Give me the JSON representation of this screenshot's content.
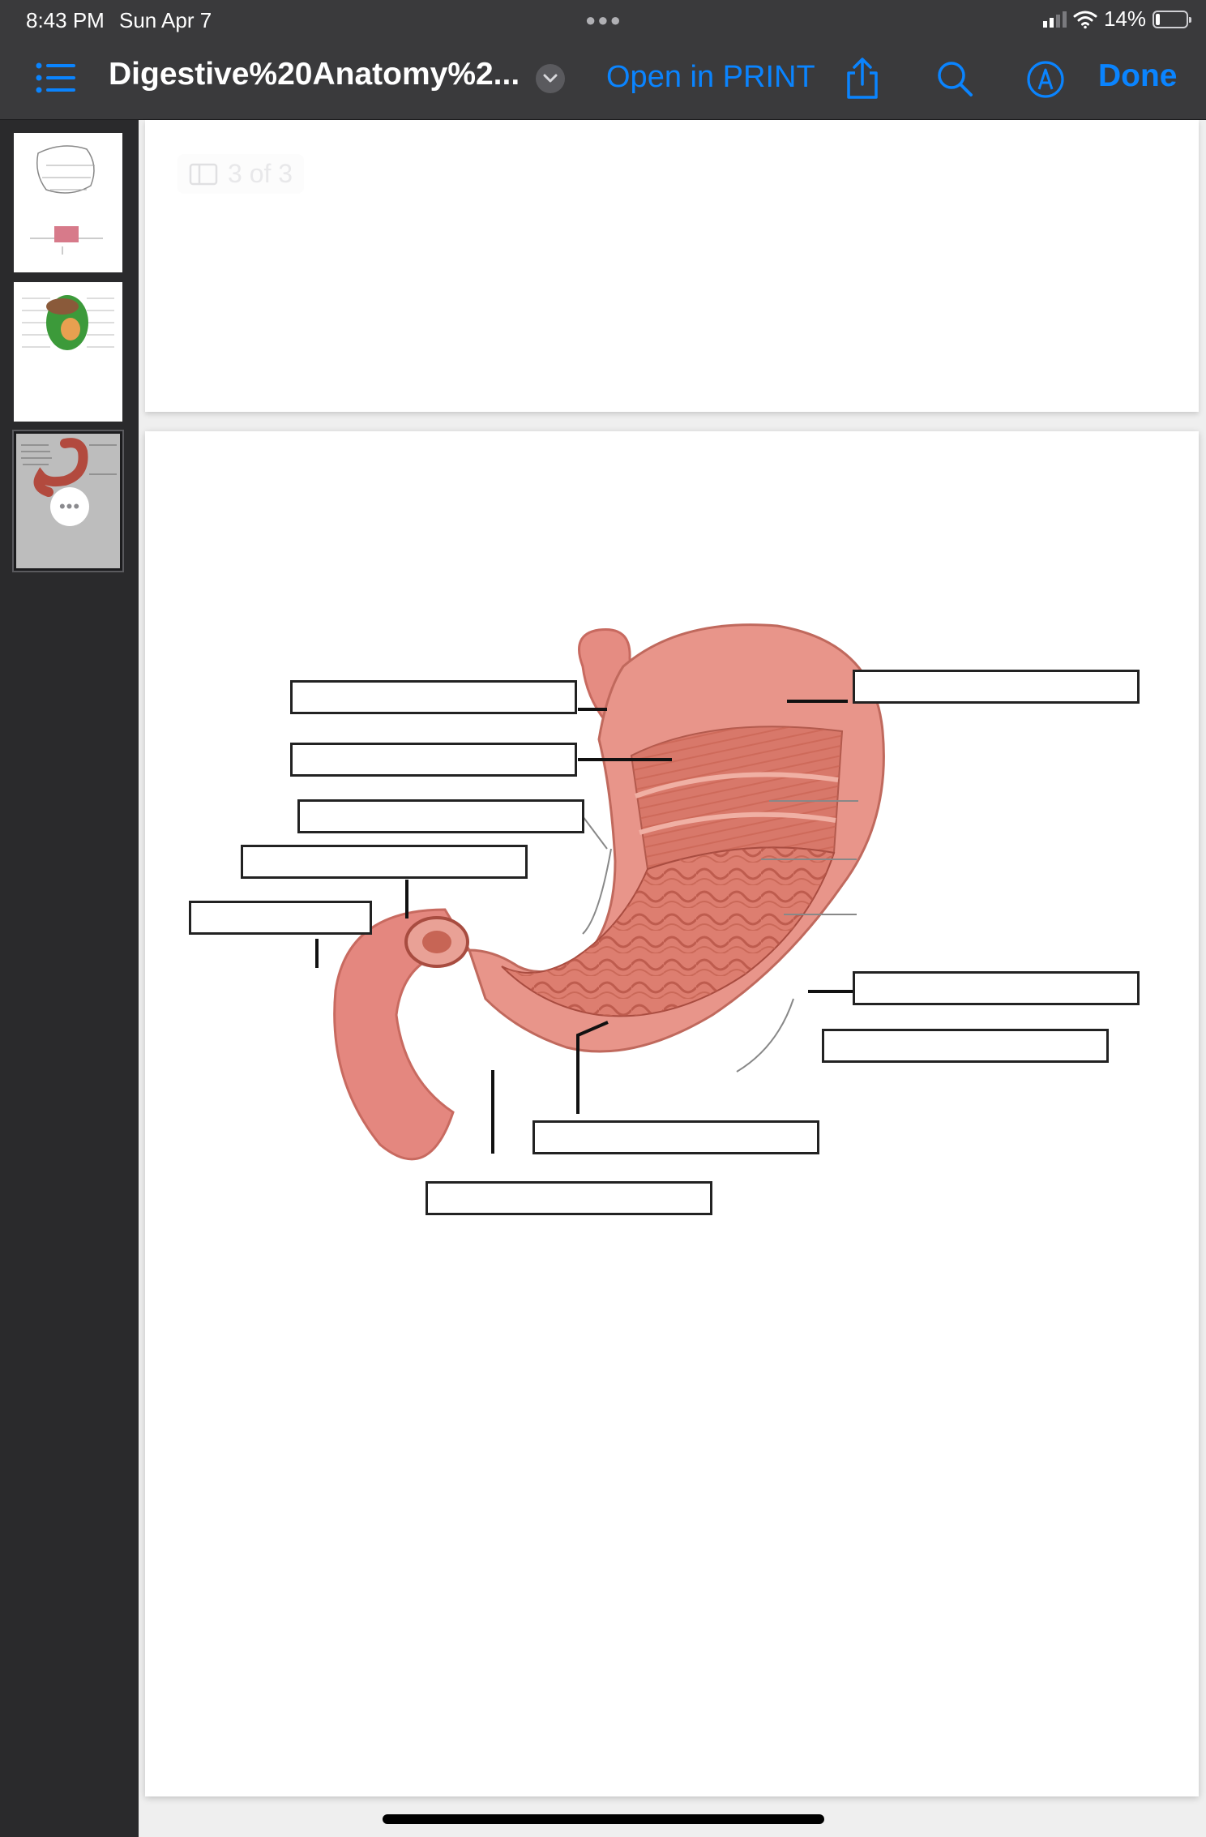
{
  "status": {
    "time": "8:43 PM",
    "date": "Sun Apr 7",
    "battery": "14%",
    "battery_level": 0.14
  },
  "toolbar": {
    "document_title": "Digestive%20Anatomy%2...",
    "open_in_label": "Open in PRINT",
    "done_label": "Done"
  },
  "viewer": {
    "page_indicator": "3 of 3"
  },
  "thumbnails": [
    {
      "page": 1,
      "selected": false
    },
    {
      "page": 2,
      "selected": false
    },
    {
      "page": 3,
      "selected": true
    }
  ],
  "colors": {
    "accent": "#0a84ff",
    "toolbar_bg": "#3a3a3c",
    "stomach": "#e08a80"
  },
  "icons": [
    "list-icon",
    "chevron-down-icon",
    "share-icon",
    "search-icon",
    "markup-icon",
    "more-icon"
  ]
}
